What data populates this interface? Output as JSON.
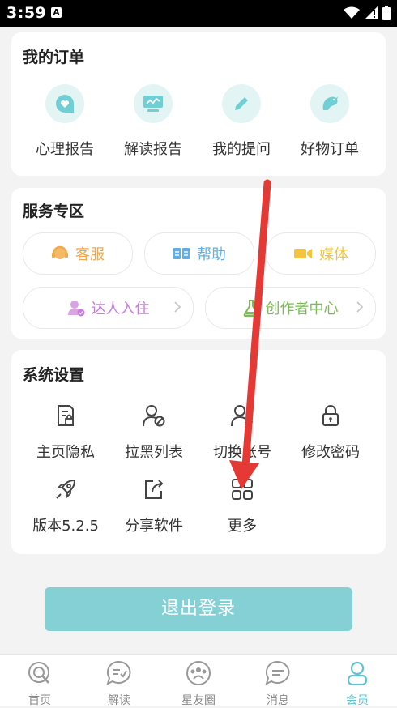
{
  "status_bar": {
    "time": "3:59",
    "notif_icon": "A"
  },
  "orders": {
    "title": "我的订单",
    "items": [
      {
        "label": "心理报告",
        "icon": "heart-chat-icon"
      },
      {
        "label": "解读报告",
        "icon": "monitor-chart-icon"
      },
      {
        "label": "我的提问",
        "icon": "pencil-icon"
      },
      {
        "label": "好物订单",
        "icon": "dolphin-icon"
      }
    ]
  },
  "service": {
    "title": "服务专区",
    "items": [
      {
        "label": "客服",
        "color": "#f0a94d"
      },
      {
        "label": "帮助",
        "color": "#63aee8"
      },
      {
        "label": "媒体",
        "color": "#f2c53d"
      },
      {
        "label": "达人入住",
        "color": "#c87bdc"
      },
      {
        "label": "创作者中心",
        "color": "#7bbd55"
      }
    ]
  },
  "settings": {
    "title": "系统设置",
    "items": [
      {
        "label": "主页隐私"
      },
      {
        "label": "拉黑列表"
      },
      {
        "label": "切换账号"
      },
      {
        "label": "修改密码"
      },
      {
        "label": "版本5.2.5"
      },
      {
        "label": "分享软件"
      },
      {
        "label": "更多"
      }
    ]
  },
  "logout_label": "退出登录",
  "tabs": [
    {
      "label": "首页",
      "active": false
    },
    {
      "label": "解读",
      "active": false
    },
    {
      "label": "星友圈",
      "active": false
    },
    {
      "label": "消息",
      "active": false
    },
    {
      "label": "会员",
      "active": true
    }
  ],
  "colors": {
    "accent": "#5fc3cf",
    "logout_bg": "#85d0d5",
    "annotation_arrow": "#e53935"
  }
}
